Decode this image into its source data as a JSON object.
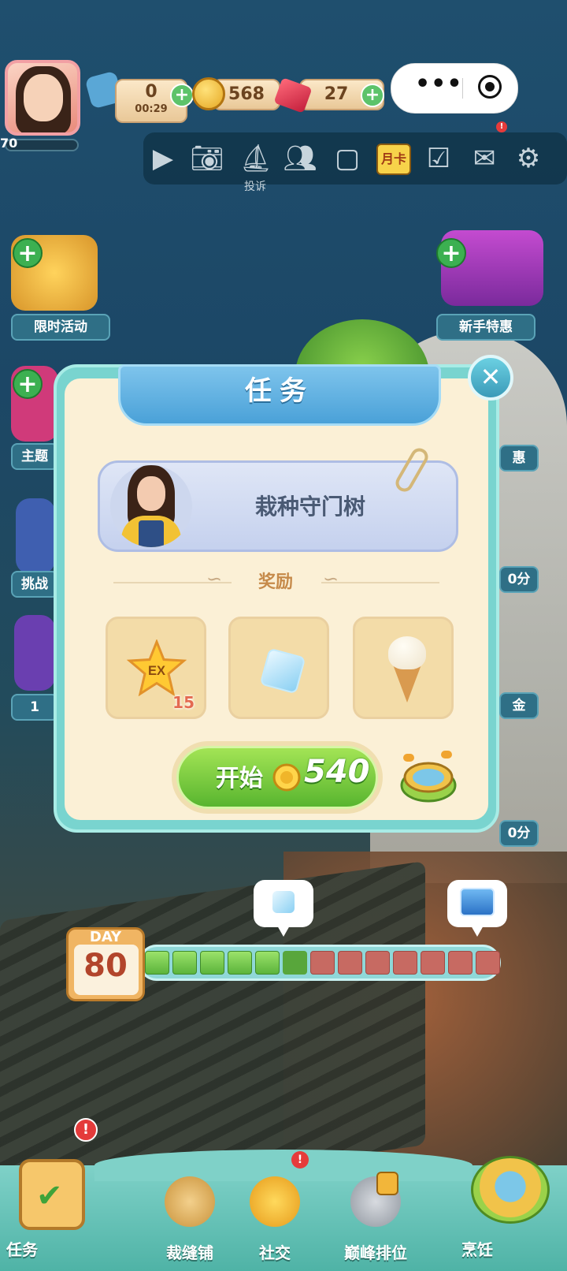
{
  "hud": {
    "level_partial": "70",
    "timer_value": "0",
    "timer_time": "00:29",
    "coins": "568",
    "gems": "27"
  },
  "toolbar": {
    "complaint_label": "投诉",
    "monthly_card_label": "月卡"
  },
  "side_left": [
    {
      "label": "限时活动"
    },
    {
      "label": "主题"
    },
    {
      "label": "挑战"
    },
    {
      "label": "1"
    }
  ],
  "side_right": [
    {
      "label": "新手特惠"
    },
    {
      "label": "惠"
    },
    {
      "label": "0分"
    },
    {
      "label": "金"
    },
    {
      "label": "0分"
    }
  ],
  "dialog": {
    "title": "任务",
    "task_name": "栽种守门树",
    "reward_title": "奖励",
    "rewards": [
      {
        "icon": "ex-star-icon",
        "qty": "15"
      },
      {
        "icon": "ice-cube-icon",
        "qty": ""
      },
      {
        "icon": "ice-cream-icon",
        "qty": ""
      }
    ],
    "start_label": "开始",
    "start_cost": "540"
  },
  "day_progress": {
    "day_label": "DAY",
    "day_number": "80",
    "filled_segments": 6,
    "total_segments": 13
  },
  "bottom_nav": [
    {
      "label": "任务"
    },
    {
      "label": "裁缝铺"
    },
    {
      "label": "社交"
    },
    {
      "label": "巅峰排位"
    },
    {
      "label": "烹饪"
    }
  ]
}
